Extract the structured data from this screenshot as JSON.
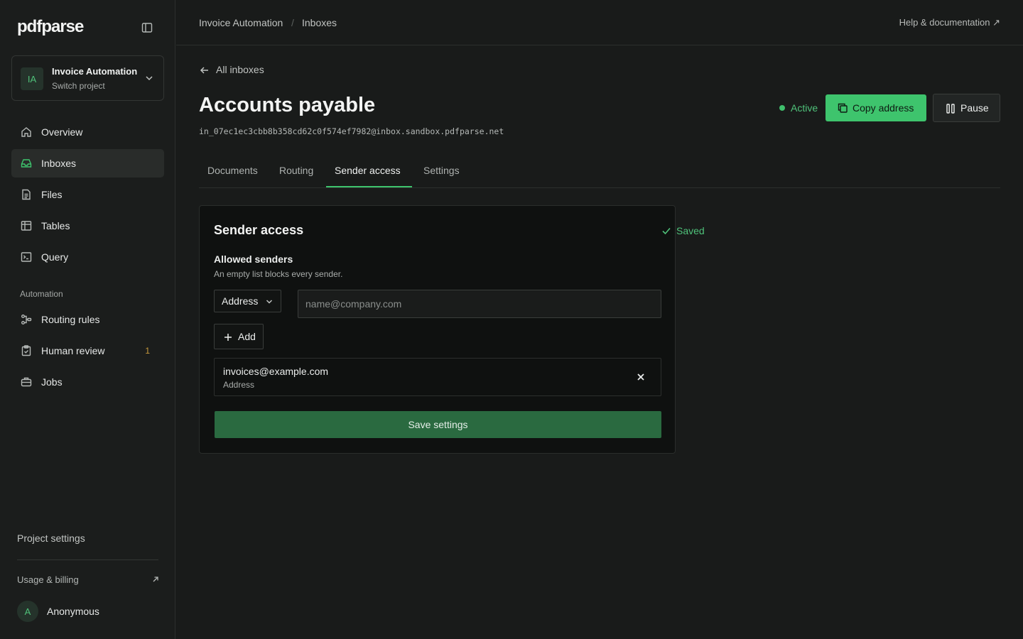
{
  "app": {
    "logo": "pdfparse"
  },
  "project": {
    "initials": "IA",
    "name": "Invoice Automation",
    "switch_label": "Switch project"
  },
  "sidebar": {
    "items": [
      {
        "label": "Overview",
        "icon": "home-icon"
      },
      {
        "label": "Inboxes",
        "icon": "inbox-icon",
        "active": true
      },
      {
        "label": "Files",
        "icon": "file-icon"
      },
      {
        "label": "Tables",
        "icon": "table-icon"
      },
      {
        "label": "Query",
        "icon": "terminal-icon"
      }
    ],
    "section_label": "Automation",
    "automation_items": [
      {
        "label": "Routing rules",
        "icon": "routing-icon"
      },
      {
        "label": "Human review",
        "icon": "clipboard-check-icon",
        "count": "1"
      },
      {
        "label": "Jobs",
        "icon": "briefcase-icon"
      }
    ],
    "project_settings": "Project settings",
    "billing": "Usage & billing",
    "user": {
      "initial": "A",
      "name": "Anonymous"
    }
  },
  "topbar": {
    "breadcrumb": [
      "Invoice Automation",
      "Inboxes"
    ],
    "separator": "/",
    "help": "Help & documentation ↗"
  },
  "inbox": {
    "back_label": "All inboxes",
    "title": "Accounts payable",
    "address": "in_07ec1ec3cbb8b358cd62c0f574ef7982@inbox.sandbox.pdfparse.net",
    "status": "Active",
    "copy_label": "Copy address",
    "pause_label": "Pause"
  },
  "tabs": [
    "Documents",
    "Routing",
    "Sender access",
    "Settings"
  ],
  "active_tab": "Sender access",
  "sender_access": {
    "title": "Sender access",
    "saved_label": "Saved",
    "allowed_label": "Allowed senders",
    "allowed_help": "An empty list blocks every sender.",
    "type_select": "Address",
    "input_placeholder": "name@company.com",
    "add_label": "Add",
    "senders": [
      {
        "value": "invoices@example.com",
        "type": "Address"
      }
    ],
    "save_label": "Save settings"
  },
  "colors": {
    "accent": "#3ec46d",
    "save_button": "#2a6a40",
    "review_count": "#c89a3c"
  }
}
